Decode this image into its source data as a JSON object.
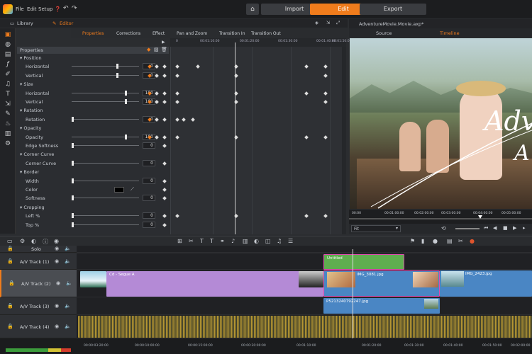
{
  "menu": {
    "file": "File",
    "edit": "Edit",
    "setup": "Setup"
  },
  "modes": {
    "import": "Import",
    "edit": "Edit",
    "export": "Export"
  },
  "library_tabs": {
    "library": "Library",
    "editor": "Editor"
  },
  "editor_tabs": [
    "Properties",
    "Corrections",
    "Effect",
    "Pan and Zoom",
    "Transition In",
    "Transition Out"
  ],
  "properties": {
    "header": "Properties",
    "rows": [
      {
        "type": "section",
        "label": "Position"
      },
      {
        "type": "param",
        "label": "Horizontal",
        "value": "0"
      },
      {
        "type": "param",
        "label": "Vertical",
        "value": "0"
      },
      {
        "type": "section",
        "label": "Size"
      },
      {
        "type": "param",
        "label": "Horizontal",
        "value": "100"
      },
      {
        "type": "param",
        "label": "Vertical",
        "value": "100"
      },
      {
        "type": "section",
        "label": "Rotation"
      },
      {
        "type": "param",
        "label": "Rotation",
        "value": "0"
      },
      {
        "type": "section",
        "label": "Opacity"
      },
      {
        "type": "param",
        "label": "Opacity",
        "value": "100"
      },
      {
        "type": "param",
        "label": "Edge Softness",
        "value": "0"
      },
      {
        "type": "section",
        "label": "Corner Curve"
      },
      {
        "type": "param",
        "label": "Corner Curve",
        "value": "0"
      },
      {
        "type": "section",
        "label": "Border"
      },
      {
        "type": "param",
        "label": "Width",
        "value": "0"
      },
      {
        "type": "param",
        "label": "Color",
        "value": ""
      },
      {
        "type": "param",
        "label": "Softness",
        "value": "0"
      },
      {
        "type": "section",
        "label": "Cropping"
      },
      {
        "type": "param",
        "label": "Left %",
        "value": "0"
      },
      {
        "type": "param",
        "label": "Top %",
        "value": "0"
      }
    ]
  },
  "keyframe_ruler": [
    "0",
    "00:01:10:00",
    "00:01:20:00",
    "00:01:30:00",
    "00:01:40:00",
    "00:01:50:00"
  ],
  "preview": {
    "title": "AdventureMovie.Movie.axp*",
    "tabs": [
      "Source",
      "Timeline"
    ],
    "overlay_text": "Adv",
    "overlay_text2": "A",
    "ruler": [
      "00:00",
      "00:01:00:00",
      "00:02:00:00",
      "00:03:00:00",
      "00:04:00:00",
      "00:05:00:00"
    ],
    "fit_label": "Fit"
  },
  "tracks": [
    {
      "name": "Solo"
    },
    {
      "name": "A/V Track (1)"
    },
    {
      "name": "A/V Track (2)"
    },
    {
      "name": "A/V Track (3)"
    },
    {
      "name": "A/V Track (4)"
    }
  ],
  "clips": {
    "title": "Untitled",
    "segue": "Cd - Segue A",
    "img1": "IMG_3081.jpg",
    "img2": "IMG_2423.jpg",
    "img3": "P5213240792247.jpg"
  },
  "timeline_ruler": [
    "00:00:03:20:00",
    "00:00:10:00:00",
    "00:00:15:00:00",
    "00:00:20:00:00",
    "00:01:10:00",
    "00:01:20:00",
    "00:01:30:00",
    "00:01:40:00",
    "00:01:50:00",
    "00:02:00:00",
    "00:02:10:00"
  ],
  "colors": {
    "accent": "#f07c1c",
    "clip_purple": "#b48ad6",
    "clip_blue": "#4a86c4",
    "clip_green": "#5fae4f",
    "audio_yellow": "#c9a634"
  }
}
